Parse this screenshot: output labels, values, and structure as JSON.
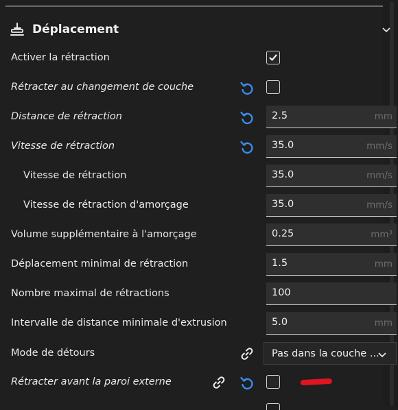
{
  "section": {
    "title": "Déplacement",
    "icon": "travel-icon",
    "expand_icon": "chevron-down-icon"
  },
  "settings": [
    {
      "label": "Activer la rétraction",
      "type": "checkbox",
      "checked": true
    },
    {
      "label": "Rétracter au changement de couche",
      "type": "checkbox",
      "checked": false,
      "reset": true
    },
    {
      "label": "Distance de rétraction",
      "type": "number",
      "value": "2.5",
      "unit": "mm",
      "reset": true
    },
    {
      "label": "Vitesse de rétraction",
      "type": "number",
      "value": "35.0",
      "unit": "mm/s",
      "reset": true
    },
    {
      "label": "Vitesse de rétraction",
      "type": "number",
      "value": "35.0",
      "unit": "mm/s"
    },
    {
      "label": "Vitesse de rétraction d'amorçage",
      "type": "number",
      "value": "35.0",
      "unit": "mm/s"
    },
    {
      "label": "Volume supplémentaire à l'amorçage",
      "type": "number",
      "value": "0.25",
      "unit": "mm³"
    },
    {
      "label": "Déplacement minimal de rétraction",
      "type": "number",
      "value": "1.5",
      "unit": "mm"
    },
    {
      "label": "Nombre maximal de rétractions",
      "type": "number",
      "value": "100",
      "unit": ""
    },
    {
      "label": "Intervalle de distance minimale d'extrusion",
      "type": "number",
      "value": "5.0",
      "unit": "mm"
    },
    {
      "label": "Mode de détours",
      "type": "select",
      "value": "Pas dans la couche ...",
      "link": true
    },
    {
      "label": "Rétracter avant la paroi externe",
      "type": "checkbox",
      "checked": false,
      "link": true,
      "reset": true
    }
  ],
  "colors": {
    "accent": "#3b8ff0",
    "background": "#1f1f1f",
    "field": "#2f2f2f",
    "annotation_mark": "#e0151f"
  }
}
